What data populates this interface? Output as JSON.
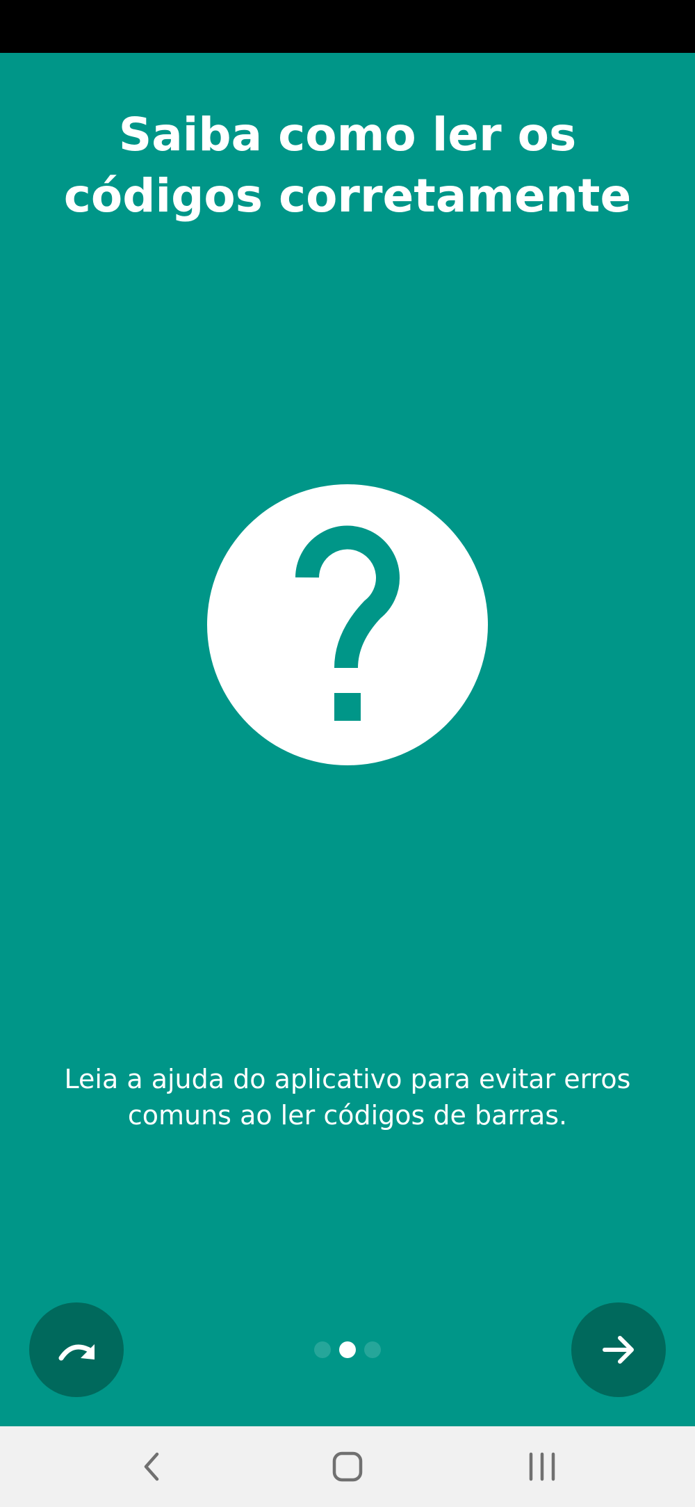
{
  "title": "Saiba como ler os códigos corretamente",
  "description": "Leia a ajuda do aplicativo para evitar erros comuns ao ler códigos de barras.",
  "icons": {
    "hero": "help-circle-icon",
    "skip": "redo-arrow-icon",
    "next": "arrow-right-icon",
    "nav_back": "chevron-left-icon",
    "nav_home": "home-outline-icon",
    "nav_recents": "recent-apps-icon"
  },
  "pager": {
    "total_pages": 3,
    "current_page": 2
  },
  "colors": {
    "background": "#009688",
    "button": "#00695C",
    "dot_active": "#FFFFFF",
    "dot_inactive": "#26A69A",
    "status_bar": "#000000",
    "nav_bar": "#F1F1F1",
    "nav_icon": "#707070"
  }
}
